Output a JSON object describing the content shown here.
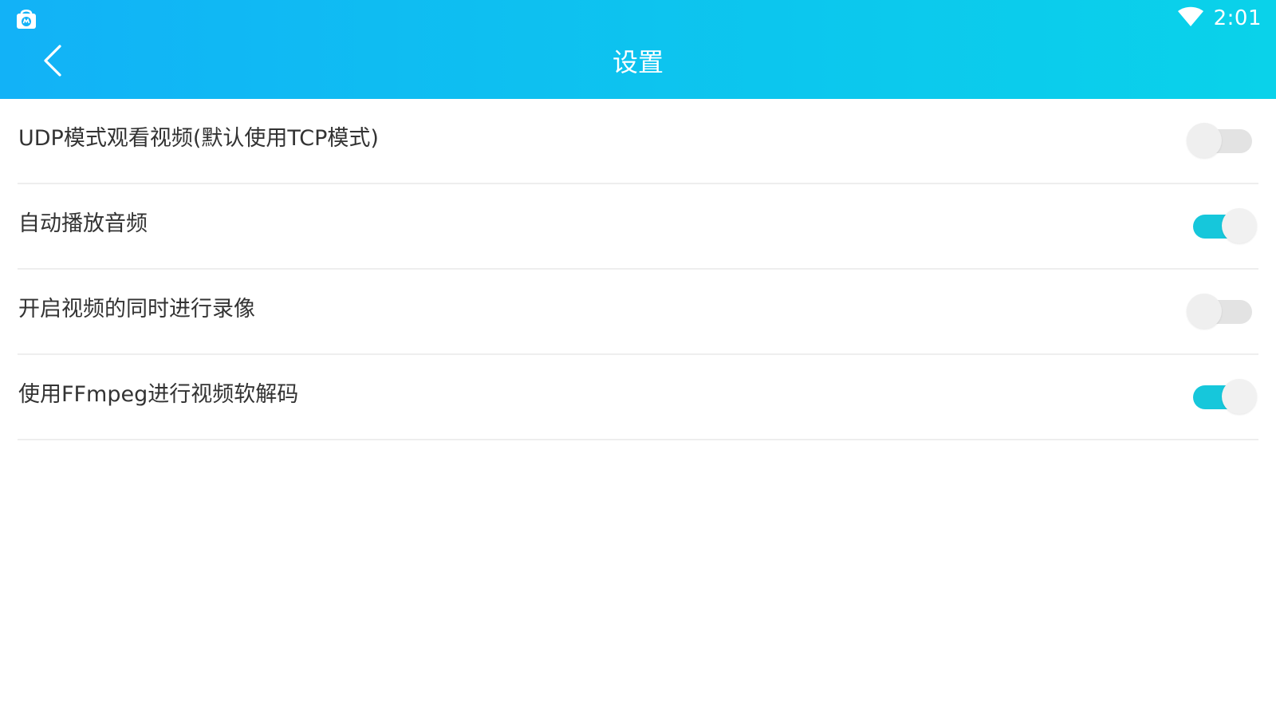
{
  "status_bar": {
    "app_icon": "shopping-bag-icon",
    "wifi_icon": "wifi-icon",
    "time": "2:01"
  },
  "header": {
    "back_icon": "chevron-left-icon",
    "title": "设置"
  },
  "settings": [
    {
      "label": "UDP模式观看视频(默认使用TCP模式)",
      "enabled": false
    },
    {
      "label": "自动播放音频",
      "enabled": true
    },
    {
      "label": "开启视频的同时进行录像",
      "enabled": false
    },
    {
      "label": "使用FFmpeg进行视频软解码",
      "enabled": true
    }
  ],
  "colors": {
    "header_gradient_start": "#12b2f7",
    "header_gradient_end": "#0ad2ea",
    "switch_on_track": "#16c7db",
    "switch_off_track": "#e3e3e3",
    "divider": "#eeeeee",
    "label_text": "#333333"
  }
}
